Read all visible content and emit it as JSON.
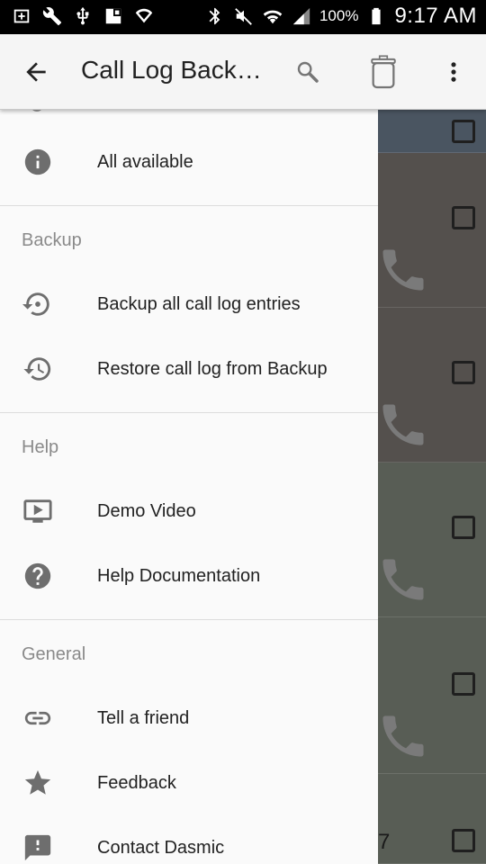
{
  "status_bar": {
    "battery_pct": "100%",
    "time": "9:17 AM",
    "left_icons": [
      "add-box-icon",
      "wrench-icon",
      "usb-icon",
      "gallery-icon",
      "shield-icon"
    ],
    "right_icons": [
      "bluetooth-icon",
      "mute-icon",
      "wifi-icon",
      "signal-icon",
      "battery-icon"
    ]
  },
  "app_bar": {
    "title": "Call Log Back…",
    "back_icon": "arrow-back-icon",
    "search_icon": "search-icon",
    "delete_icon": "trash-icon",
    "overflow_icon": "more-vert-icon"
  },
  "drawer": {
    "top_item": {
      "label": "All available",
      "icon": "info-icon"
    },
    "sections": [
      {
        "title": "Backup",
        "items": [
          {
            "label": "Backup all call log entries",
            "icon": "backup-restore-icon"
          },
          {
            "label": "Restore call log from Backup",
            "icon": "restore-history-icon"
          }
        ]
      },
      {
        "title": "Help",
        "items": [
          {
            "label": "Demo Video",
            "icon": "video-icon"
          },
          {
            "label": "Help Documentation",
            "icon": "help-icon"
          }
        ]
      },
      {
        "title": "General",
        "items": [
          {
            "label": "Tell a friend",
            "icon": "link-icon"
          },
          {
            "label": "Feedback",
            "icon": "star-icon"
          },
          {
            "label": "Contact Dasmic",
            "icon": "feedback-icon"
          }
        ]
      }
    ]
  },
  "background_list": {
    "row_colors": [
      "#4a5561",
      "#54504d",
      "#54504d",
      "#585d55",
      "#585d55",
      "#585d55"
    ],
    "partial_text": "7"
  }
}
